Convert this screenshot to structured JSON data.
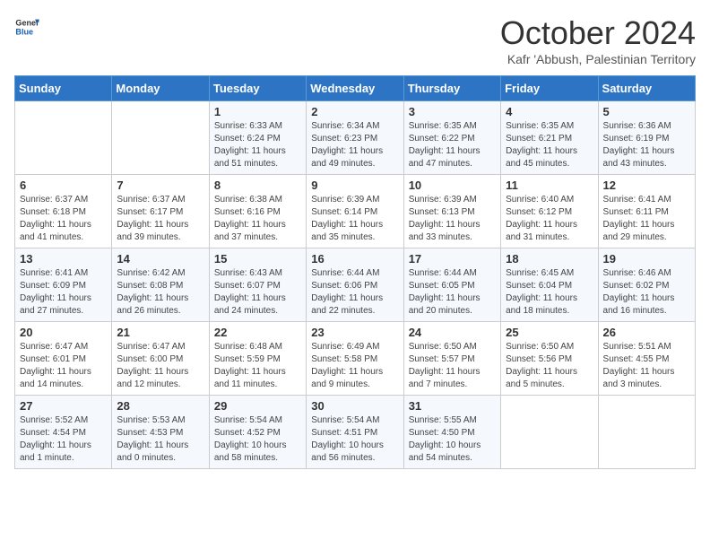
{
  "logo": {
    "line1": "General",
    "line2": "Blue"
  },
  "title": "October 2024",
  "subtitle": "Kafr 'Abbush, Palestinian Territory",
  "days_of_week": [
    "Sunday",
    "Monday",
    "Tuesday",
    "Wednesday",
    "Thursday",
    "Friday",
    "Saturday"
  ],
  "weeks": [
    [
      {
        "day": "",
        "info": ""
      },
      {
        "day": "",
        "info": ""
      },
      {
        "day": "1",
        "info": "Sunrise: 6:33 AM\nSunset: 6:24 PM\nDaylight: 11 hours and 51 minutes."
      },
      {
        "day": "2",
        "info": "Sunrise: 6:34 AM\nSunset: 6:23 PM\nDaylight: 11 hours and 49 minutes."
      },
      {
        "day": "3",
        "info": "Sunrise: 6:35 AM\nSunset: 6:22 PM\nDaylight: 11 hours and 47 minutes."
      },
      {
        "day": "4",
        "info": "Sunrise: 6:35 AM\nSunset: 6:21 PM\nDaylight: 11 hours and 45 minutes."
      },
      {
        "day": "5",
        "info": "Sunrise: 6:36 AM\nSunset: 6:19 PM\nDaylight: 11 hours and 43 minutes."
      }
    ],
    [
      {
        "day": "6",
        "info": "Sunrise: 6:37 AM\nSunset: 6:18 PM\nDaylight: 11 hours and 41 minutes."
      },
      {
        "day": "7",
        "info": "Sunrise: 6:37 AM\nSunset: 6:17 PM\nDaylight: 11 hours and 39 minutes."
      },
      {
        "day": "8",
        "info": "Sunrise: 6:38 AM\nSunset: 6:16 PM\nDaylight: 11 hours and 37 minutes."
      },
      {
        "day": "9",
        "info": "Sunrise: 6:39 AM\nSunset: 6:14 PM\nDaylight: 11 hours and 35 minutes."
      },
      {
        "day": "10",
        "info": "Sunrise: 6:39 AM\nSunset: 6:13 PM\nDaylight: 11 hours and 33 minutes."
      },
      {
        "day": "11",
        "info": "Sunrise: 6:40 AM\nSunset: 6:12 PM\nDaylight: 11 hours and 31 minutes."
      },
      {
        "day": "12",
        "info": "Sunrise: 6:41 AM\nSunset: 6:11 PM\nDaylight: 11 hours and 29 minutes."
      }
    ],
    [
      {
        "day": "13",
        "info": "Sunrise: 6:41 AM\nSunset: 6:09 PM\nDaylight: 11 hours and 27 minutes."
      },
      {
        "day": "14",
        "info": "Sunrise: 6:42 AM\nSunset: 6:08 PM\nDaylight: 11 hours and 26 minutes."
      },
      {
        "day": "15",
        "info": "Sunrise: 6:43 AM\nSunset: 6:07 PM\nDaylight: 11 hours and 24 minutes."
      },
      {
        "day": "16",
        "info": "Sunrise: 6:44 AM\nSunset: 6:06 PM\nDaylight: 11 hours and 22 minutes."
      },
      {
        "day": "17",
        "info": "Sunrise: 6:44 AM\nSunset: 6:05 PM\nDaylight: 11 hours and 20 minutes."
      },
      {
        "day": "18",
        "info": "Sunrise: 6:45 AM\nSunset: 6:04 PM\nDaylight: 11 hours and 18 minutes."
      },
      {
        "day": "19",
        "info": "Sunrise: 6:46 AM\nSunset: 6:02 PM\nDaylight: 11 hours and 16 minutes."
      }
    ],
    [
      {
        "day": "20",
        "info": "Sunrise: 6:47 AM\nSunset: 6:01 PM\nDaylight: 11 hours and 14 minutes."
      },
      {
        "day": "21",
        "info": "Sunrise: 6:47 AM\nSunset: 6:00 PM\nDaylight: 11 hours and 12 minutes."
      },
      {
        "day": "22",
        "info": "Sunrise: 6:48 AM\nSunset: 5:59 PM\nDaylight: 11 hours and 11 minutes."
      },
      {
        "day": "23",
        "info": "Sunrise: 6:49 AM\nSunset: 5:58 PM\nDaylight: 11 hours and 9 minutes."
      },
      {
        "day": "24",
        "info": "Sunrise: 6:50 AM\nSunset: 5:57 PM\nDaylight: 11 hours and 7 minutes."
      },
      {
        "day": "25",
        "info": "Sunrise: 6:50 AM\nSunset: 5:56 PM\nDaylight: 11 hours and 5 minutes."
      },
      {
        "day": "26",
        "info": "Sunrise: 5:51 AM\nSunset: 4:55 PM\nDaylight: 11 hours and 3 minutes."
      }
    ],
    [
      {
        "day": "27",
        "info": "Sunrise: 5:52 AM\nSunset: 4:54 PM\nDaylight: 11 hours and 1 minute."
      },
      {
        "day": "28",
        "info": "Sunrise: 5:53 AM\nSunset: 4:53 PM\nDaylight: 11 hours and 0 minutes."
      },
      {
        "day": "29",
        "info": "Sunrise: 5:54 AM\nSunset: 4:52 PM\nDaylight: 10 hours and 58 minutes."
      },
      {
        "day": "30",
        "info": "Sunrise: 5:54 AM\nSunset: 4:51 PM\nDaylight: 10 hours and 56 minutes."
      },
      {
        "day": "31",
        "info": "Sunrise: 5:55 AM\nSunset: 4:50 PM\nDaylight: 10 hours and 54 minutes."
      },
      {
        "day": "",
        "info": ""
      },
      {
        "day": "",
        "info": ""
      }
    ]
  ]
}
